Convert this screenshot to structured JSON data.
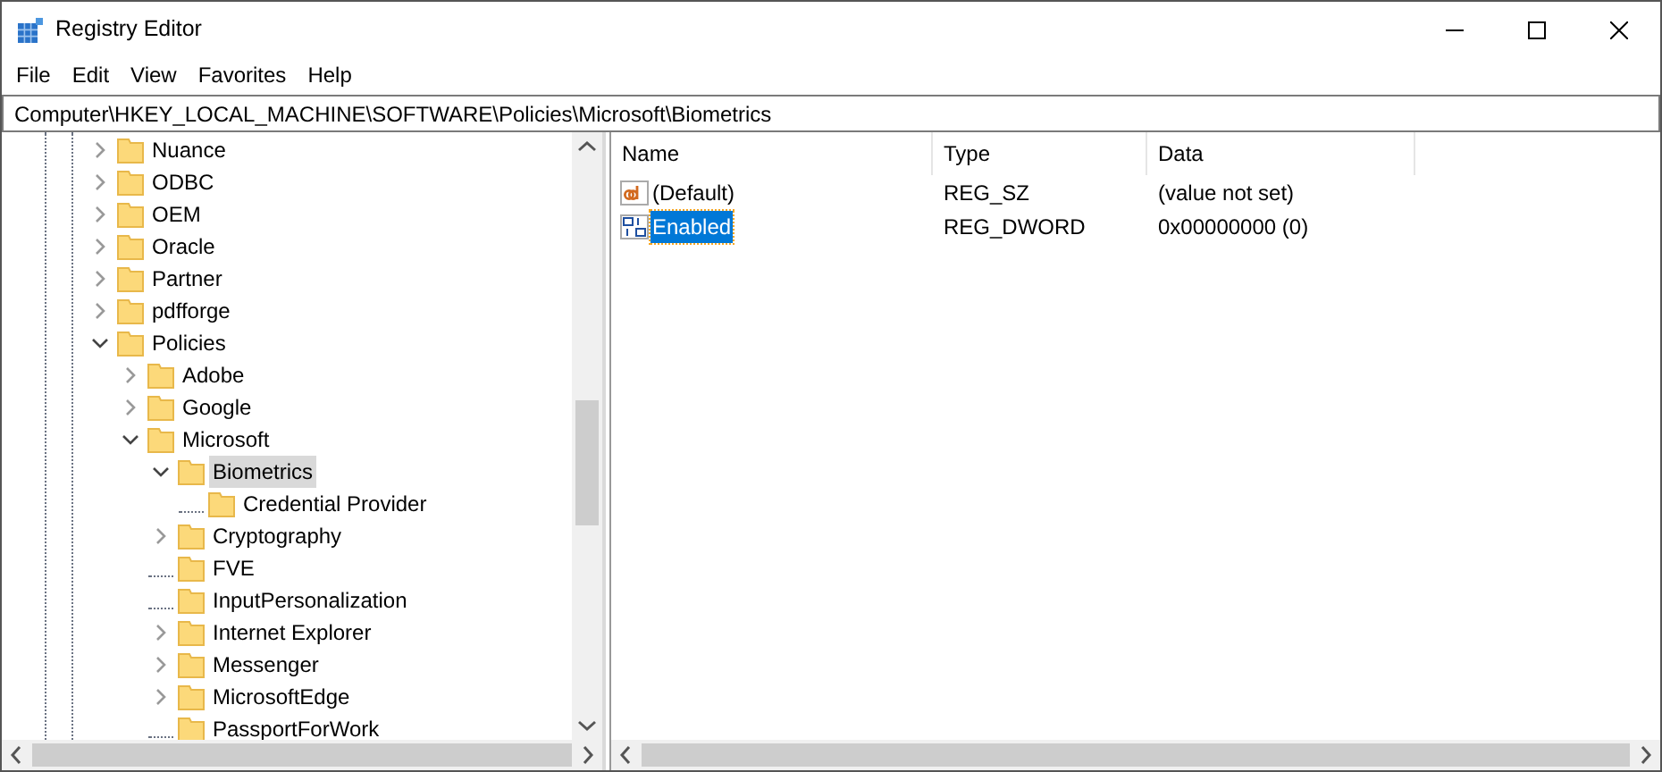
{
  "window": {
    "title": "Registry Editor"
  },
  "menu": [
    "File",
    "Edit",
    "View",
    "Favorites",
    "Help"
  ],
  "address": "Computer\\HKEY_LOCAL_MACHINE\\SOFTWARE\\Policies\\Microsoft\\Biometrics",
  "tree": [
    {
      "label": "Nuance",
      "kind": "branch",
      "expanded": false,
      "selected": false
    },
    {
      "label": "ODBC",
      "kind": "branch",
      "expanded": false,
      "selected": false
    },
    {
      "label": "OEM",
      "kind": "branch",
      "expanded": false,
      "selected": false
    },
    {
      "label": "Oracle",
      "kind": "branch",
      "expanded": false,
      "selected": false
    },
    {
      "label": "Partner",
      "kind": "branch",
      "expanded": false,
      "selected": false
    },
    {
      "label": "pdfforge",
      "kind": "branch",
      "expanded": false,
      "selected": false
    },
    {
      "label": "Policies",
      "kind": "branch",
      "expanded": true,
      "selected": false,
      "children": [
        {
          "label": "Adobe",
          "kind": "branch",
          "expanded": false,
          "selected": false
        },
        {
          "label": "Google",
          "kind": "branch",
          "expanded": false,
          "selected": false
        },
        {
          "label": "Microsoft",
          "kind": "branch",
          "expanded": true,
          "selected": false,
          "children": [
            {
              "label": "Biometrics",
              "kind": "branch",
              "expanded": true,
              "selected": true,
              "children": [
                {
                  "label": "Credential Provider",
                  "kind": "leaf",
                  "expanded": false,
                  "selected": false
                }
              ]
            },
            {
              "label": "Cryptography",
              "kind": "branch",
              "expanded": false,
              "selected": false
            },
            {
              "label": "FVE",
              "kind": "leaf",
              "expanded": false,
              "selected": false
            },
            {
              "label": "InputPersonalization",
              "kind": "leaf",
              "expanded": false,
              "selected": false
            },
            {
              "label": "Internet Explorer",
              "kind": "branch",
              "expanded": false,
              "selected": false
            },
            {
              "label": "Messenger",
              "kind": "branch",
              "expanded": false,
              "selected": false
            },
            {
              "label": "MicrosoftEdge",
              "kind": "branch",
              "expanded": false,
              "selected": false
            },
            {
              "label": "PassportForWork",
              "kind": "leaf",
              "expanded": false,
              "selected": false
            }
          ]
        }
      ]
    }
  ],
  "values": {
    "columns": [
      "Name",
      "Type",
      "Data"
    ],
    "rows": [
      {
        "name": "(Default)",
        "kind": "string",
        "type": "REG_SZ",
        "data": "(value not set)",
        "selected": false
      },
      {
        "name": "Enabled",
        "kind": "dword",
        "type": "REG_DWORD",
        "data": "0x00000000 (0)",
        "selected": true
      }
    ]
  }
}
